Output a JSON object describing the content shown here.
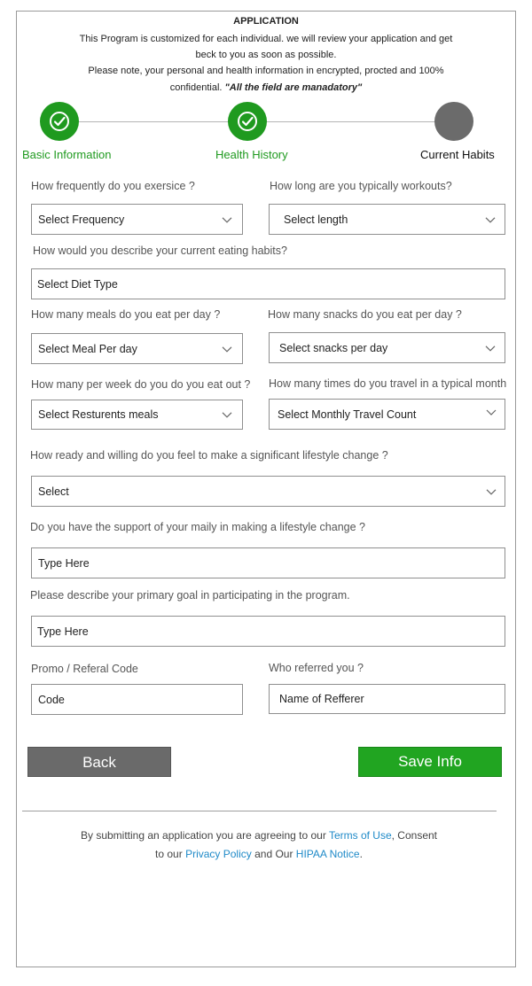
{
  "header": {
    "title": "APPLICATION",
    "line1": "This Program is customized for each individual. we will review your application and get",
    "line2": "beck to you as soon as possible.",
    "line3": "Please note, your personal and health information in encrypted, procted and 100%",
    "line4_prefix": "confidential.",
    "line4_emphasis": "\"All the field are manadatory\""
  },
  "steps": [
    {
      "label": "Basic Information",
      "status": "done",
      "icon": "check-circle-icon"
    },
    {
      "label": "Health History",
      "status": "done",
      "icon": "check-circle-icon"
    },
    {
      "label": "Current Habits",
      "status": "current",
      "icon": "circle-icon"
    }
  ],
  "form": {
    "exercise_q": "How frequently do you exersice ?",
    "exercise_value": "Select Frequency",
    "workout_q": "How long are you typically workouts?",
    "workout_value": "Select length",
    "diet_q": "How would you describe your current eating habits?",
    "diet_value": "Select Diet Type",
    "meals_q": "How many meals do you eat per day ?",
    "meals_value": "Select Meal Per day",
    "snacks_q": "How many snacks do you eat per day ?",
    "snacks_value": "Select snacks per day",
    "eatout_q": "How many per week do you do you eat out ?",
    "eatout_value": "Select Resturents meals",
    "travel_q": "How many times do you travel in a typical month",
    "travel_value": "Select Monthly Travel Count",
    "ready_q": "How ready and willing do you feel to make a significant lifestyle change ?",
    "ready_value": "Select",
    "support_q": "Do you have the support of your maily in making a lifestyle change ?",
    "support_placeholder": "Type Here",
    "goal_q": "Please describe your primary goal in participating in the program.",
    "goal_placeholder": "Type Here",
    "promo_q": "Promo / Referal Code",
    "promo_placeholder": "Code",
    "referrer_q": "Who referred you ?",
    "referrer_placeholder": "Name of Refferer"
  },
  "buttons": {
    "back": "Back",
    "save": "Save Info"
  },
  "footer": {
    "part1": "By submitting an application you are agreeing to our",
    "terms_link": "Terms of Use",
    "part2": ", Consent",
    "part3": "to our",
    "privacy_link": "Privacy Policy",
    "part4": "and Our",
    "hipaa_link": "HIPAA Notice",
    "part5": "."
  },
  "colors": {
    "accent_green": "#1f9a1f",
    "button_green": "#21a521",
    "button_gray": "#6a6a6a",
    "link_blue": "#1f8ac8"
  }
}
